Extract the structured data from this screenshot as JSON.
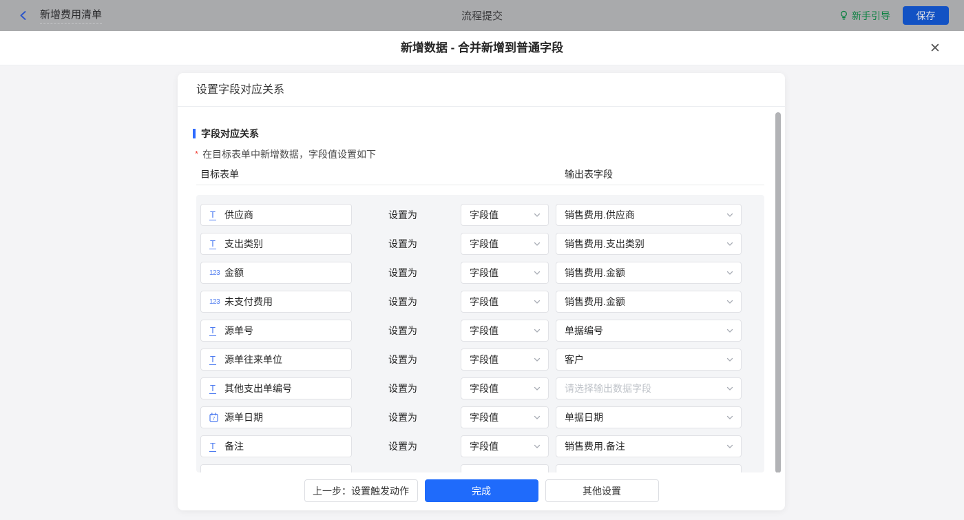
{
  "topbar": {
    "back_label": "新增费用清单",
    "center_title": "流程提交",
    "guide_label": "新手引导",
    "save_label": "保存"
  },
  "modal": {
    "title": "新增数据 - 合并新增到普通字段",
    "close_glyph": "✕"
  },
  "card": {
    "header": "设置字段对应关系",
    "section_title": "字段对应关系",
    "required_mark": "*",
    "required_note": "在目标表单中新增数据，字段值设置如下",
    "col_left": "目标表单",
    "col_right": "输出表字段",
    "rows": [
      {
        "icon": "text-field-icon",
        "field": "供应商",
        "set_as": "设置为",
        "mode": "字段值",
        "output": "销售费用.供应商",
        "placeholder": false,
        "partial": false
      },
      {
        "icon": "text-field-icon",
        "field": "支出类别",
        "set_as": "设置为",
        "mode": "字段值",
        "output": "销售费用.支出类别",
        "placeholder": false,
        "partial": false
      },
      {
        "icon": "number-field-icon",
        "field": "金额",
        "set_as": "设置为",
        "mode": "字段值",
        "output": "销售费用.金额",
        "placeholder": false,
        "partial": false
      },
      {
        "icon": "number-field-icon",
        "field": "未支付费用",
        "set_as": "设置为",
        "mode": "字段值",
        "output": "销售费用.金额",
        "placeholder": false,
        "partial": false
      },
      {
        "icon": "text-field-icon",
        "field": "源单号",
        "set_as": "设置为",
        "mode": "字段值",
        "output": "单据编号",
        "placeholder": false,
        "partial": false
      },
      {
        "icon": "text-field-icon",
        "field": "源单往来单位",
        "set_as": "设置为",
        "mode": "字段值",
        "output": "客户",
        "placeholder": false,
        "partial": false
      },
      {
        "icon": "text-field-icon",
        "field": "其他支出单编号",
        "set_as": "设置为",
        "mode": "字段值",
        "output": "请选择输出数据字段",
        "placeholder": true,
        "partial": false
      },
      {
        "icon": "date-field-icon",
        "field": "源单日期",
        "set_as": "设置为",
        "mode": "字段值",
        "output": "单据日期",
        "placeholder": false,
        "partial": false
      },
      {
        "icon": "text-field-icon",
        "field": "备注",
        "set_as": "设置为",
        "mode": "字段值",
        "output": "销售费用.备注",
        "placeholder": false,
        "partial": false
      },
      {
        "icon": "",
        "field": "",
        "set_as": "",
        "mode": "",
        "output": "",
        "placeholder": false,
        "partial": true
      }
    ],
    "footer": {
      "prev_label": "上一步：设置触发动作",
      "done_label": "完成",
      "other_label": "其他设置"
    }
  },
  "colors": {
    "accent_blue": "#1f6bfb",
    "section_bar_blue": "#2f6bff",
    "field_icon_blue": "#4d7bf0",
    "guide_green": "#0e8142",
    "required_red": "#f2483f",
    "topbar_dimmed_gray": "#a9aaac",
    "panel_gray": "#f4f5f7"
  }
}
